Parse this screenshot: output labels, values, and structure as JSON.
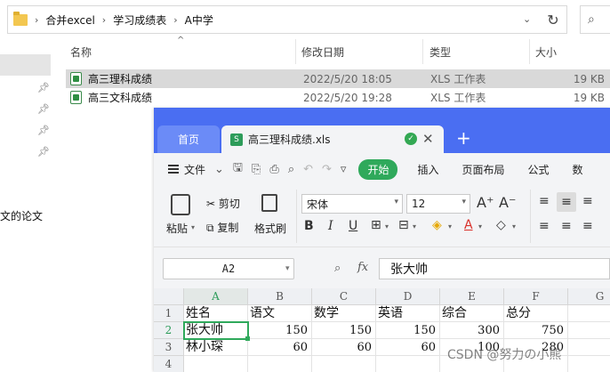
{
  "explorer": {
    "breadcrumb": [
      "合并excel",
      "学习成绩表",
      "A中学"
    ],
    "columns": {
      "name": "名称",
      "date": "修改日期",
      "type": "类型",
      "size": "大小"
    },
    "nav_partial_text": "文的论文",
    "files": [
      {
        "name": "高三理科成绩",
        "date": "2022/5/20 18:05",
        "type": "XLS 工作表",
        "size": "19 KB",
        "selected": true
      },
      {
        "name": "高三文科成绩",
        "date": "2022/5/20 19:28",
        "type": "XLS 工作表",
        "size": "19 KB",
        "selected": false
      }
    ]
  },
  "wps": {
    "tabs": {
      "home": "首页",
      "document": "高三理科成绩.xls"
    },
    "menu": {
      "file": "文件",
      "start": "开始",
      "insert": "插入",
      "page_layout": "页面布局",
      "formula": "公式",
      "data_partial": "数"
    },
    "ribbon": {
      "paste": "粘贴",
      "cut": "剪切",
      "copy": "复制",
      "format_painter": "格式刷",
      "font_name": "宋体",
      "font_size": "12"
    },
    "formula_bar": {
      "cell_ref": "A2",
      "content": "张大帅"
    },
    "sheet": {
      "columns": [
        "A",
        "B",
        "C",
        "D",
        "E",
        "F",
        "G"
      ],
      "rows": [
        "1",
        "2",
        "3",
        "4"
      ],
      "data": [
        [
          "姓名",
          "语文",
          "数学",
          "英语",
          "综合",
          "总分"
        ],
        [
          "张大帅",
          "150",
          "150",
          "150",
          "300",
          "750"
        ],
        [
          "林小琛",
          "60",
          "60",
          "60",
          "100",
          "280"
        ]
      ]
    }
  },
  "watermark": "CSDN @努力の小熊",
  "colors": {
    "wps_blue": "#4a6ef2",
    "wps_green": "#2fa95b",
    "selection": "#d9d9d9"
  }
}
